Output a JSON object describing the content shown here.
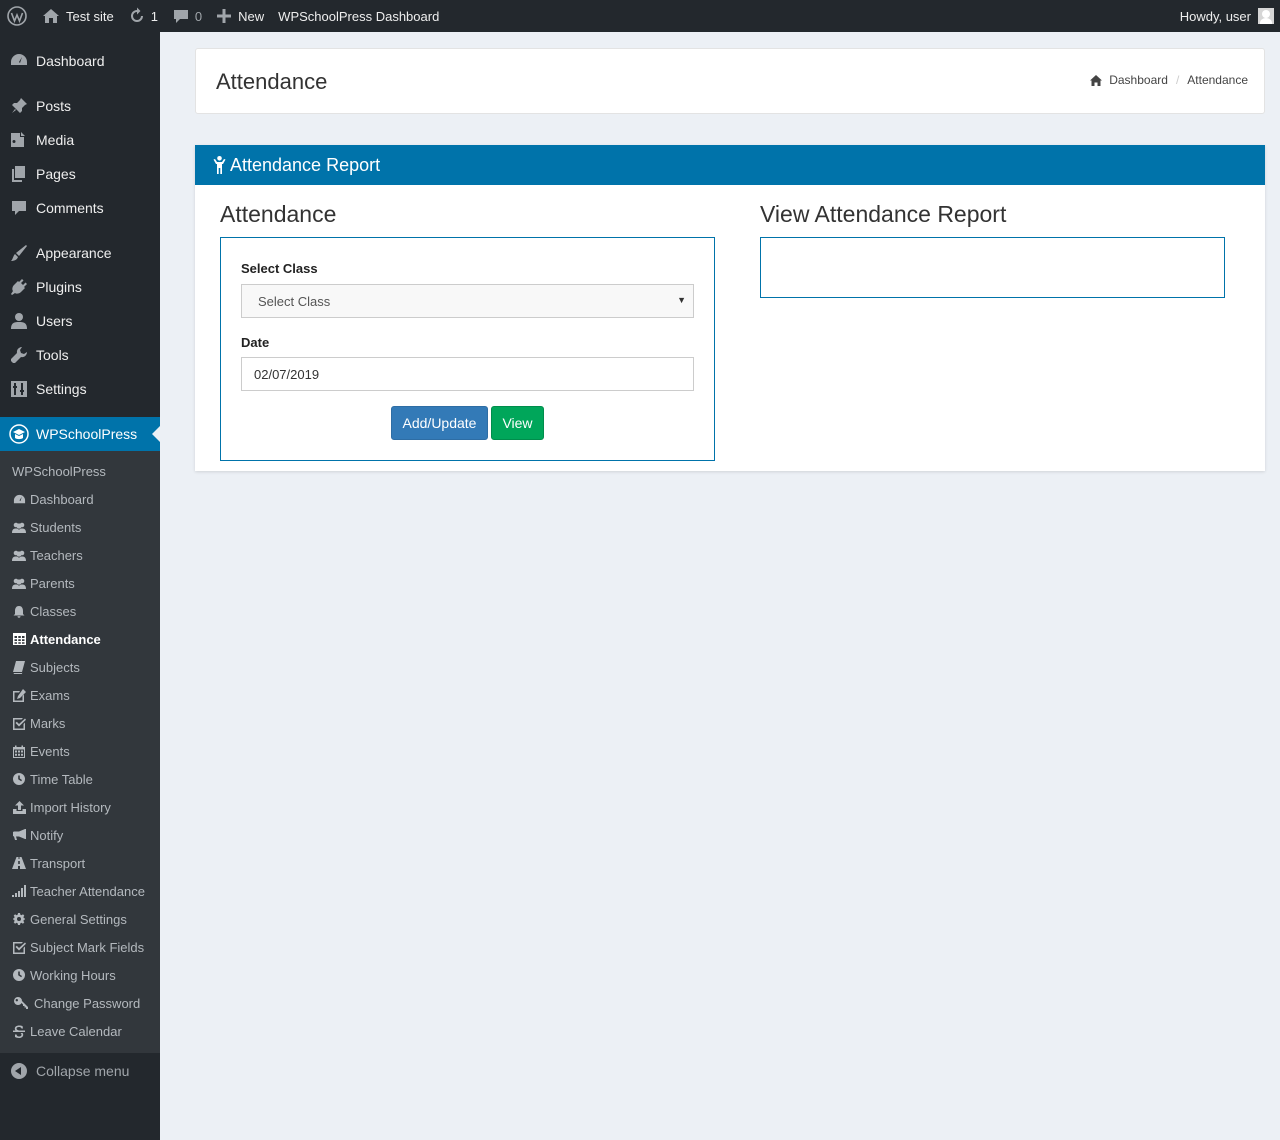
{
  "adminbar": {
    "site_name": "Test site",
    "updates_count": "1",
    "comments_count": "0",
    "new_label": "New",
    "dashboard_link": "WPSchoolPress Dashboard",
    "howdy": "Howdy, user"
  },
  "sidebar": {
    "items": [
      {
        "label": "Dashboard",
        "icon": "dashboard-icon"
      },
      {
        "label": "Posts",
        "icon": "pin-icon"
      },
      {
        "label": "Media",
        "icon": "media-icon"
      },
      {
        "label": "Pages",
        "icon": "pages-icon"
      },
      {
        "label": "Comments",
        "icon": "comment-icon"
      },
      {
        "label": "Appearance",
        "icon": "brush-icon"
      },
      {
        "label": "Plugins",
        "icon": "plugin-icon"
      },
      {
        "label": "Users",
        "icon": "user-icon"
      },
      {
        "label": "Tools",
        "icon": "wrench-icon"
      },
      {
        "label": "Settings",
        "icon": "settings-icon"
      }
    ],
    "active": {
      "label": "WPSchoolPress",
      "icon": "wpschoolpress-icon"
    },
    "submenu_head": "WPSchoolPress",
    "submenu": [
      {
        "label": "Dashboard",
        "icon": "dashboard-icon"
      },
      {
        "label": "Students",
        "icon": "users-icon"
      },
      {
        "label": "Teachers",
        "icon": "users-icon"
      },
      {
        "label": "Parents",
        "icon": "users-icon"
      },
      {
        "label": "Classes",
        "icon": "bell-icon"
      },
      {
        "label": "Attendance",
        "icon": "table-icon"
      },
      {
        "label": "Subjects",
        "icon": "book-icon"
      },
      {
        "label": "Exams",
        "icon": "edit-icon"
      },
      {
        "label": "Marks",
        "icon": "check-square-icon"
      },
      {
        "label": "Events",
        "icon": "calendar-icon"
      },
      {
        "label": "Time Table",
        "icon": "clock-icon"
      },
      {
        "label": "Import History",
        "icon": "upload-icon"
      },
      {
        "label": "Notify",
        "icon": "bullhorn-icon"
      },
      {
        "label": "Transport",
        "icon": "road-icon"
      },
      {
        "label": "Teacher Attendance",
        "icon": "signal-icon"
      },
      {
        "label": "General Settings",
        "icon": "gear-icon"
      },
      {
        "label": "Subject Mark Fields",
        "icon": "check-square-icon"
      },
      {
        "label": "Working Hours",
        "icon": "clock-icon"
      },
      {
        "label": "Change Password",
        "icon": "key-icon"
      },
      {
        "label": "Leave Calendar",
        "icon": "strikethrough-icon"
      }
    ],
    "current_submenu": "Attendance",
    "collapse_label": "Collapse menu"
  },
  "header": {
    "title": "Attendance",
    "breadcrumb_home": "Dashboard",
    "breadcrumb_current": "Attendance"
  },
  "panel": {
    "title": "Attendance Report",
    "left_title": "Attendance",
    "right_title": "View Attendance Report",
    "class_label": "Select Class",
    "class_selected": "Select Class",
    "date_label": "Date",
    "date_value": "02/07/2019",
    "add_button": "Add/Update",
    "view_button": "View"
  },
  "colors": {
    "adminbar_bg": "#23282d",
    "accent_blue": "#0073aa",
    "primary_button": "#337ab7",
    "success_button": "#00a65a",
    "content_bg": "#ecf0f5"
  }
}
